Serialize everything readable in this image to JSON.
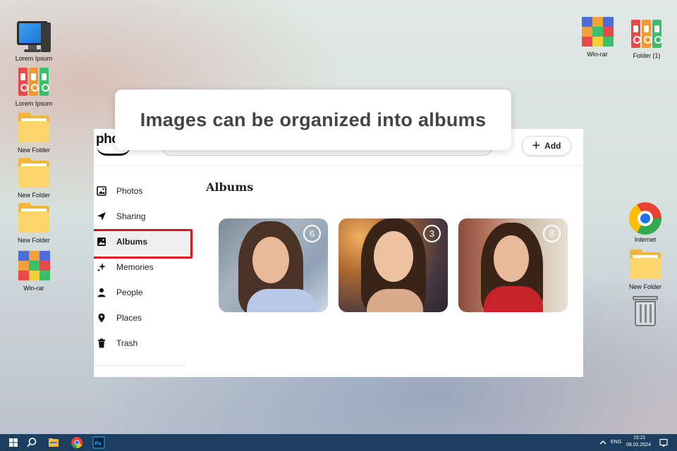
{
  "desktop": {
    "left_icons": [
      {
        "label": "Lorem Ipsum",
        "icon": "computer-icon"
      },
      {
        "label": "Lorem Ipsum",
        "icon": "binders-icon"
      },
      {
        "label": "New Folder",
        "icon": "folder-icon"
      },
      {
        "label": "New Folder",
        "icon": "folder-icon"
      },
      {
        "label": "New Folder",
        "icon": "folder-icon"
      },
      {
        "label": "Win-rar",
        "icon": "winrar-icon"
      }
    ],
    "right_icons": [
      {
        "label": "Win-rar",
        "icon": "winrar-icon"
      },
      {
        "label": "Folder (1)",
        "icon": "binders-icon"
      },
      {
        "label": "Internet",
        "icon": "chrome-icon"
      },
      {
        "label": "New Folder",
        "icon": "folder-icon"
      },
      {
        "label": "",
        "icon": "trash-icon"
      }
    ]
  },
  "app": {
    "logo_text": "pho",
    "add_label": "Add",
    "sidebar": [
      {
        "label": "Photos",
        "icon": "photo-icon"
      },
      {
        "label": "Sharing",
        "icon": "send-icon"
      },
      {
        "label": "Albums",
        "icon": "albums-icon",
        "active": true
      },
      {
        "label": "Memories",
        "icon": "sparkles-icon"
      },
      {
        "label": "People",
        "icon": "person-icon"
      },
      {
        "label": "Places",
        "icon": "pin-icon"
      },
      {
        "label": "Trash",
        "icon": "trash-icon"
      }
    ],
    "main_title": "Albums",
    "albums": [
      {
        "count": "6"
      },
      {
        "count": "3"
      },
      {
        "count": "8"
      }
    ]
  },
  "tooltip": {
    "text": "Images can be organized into albums"
  },
  "taskbar": {
    "language": "ENG",
    "time": "15:21",
    "date": "08.02.2024"
  },
  "colors": {
    "highlight": "#e0141e",
    "taskbar": "#1d3f5f"
  }
}
